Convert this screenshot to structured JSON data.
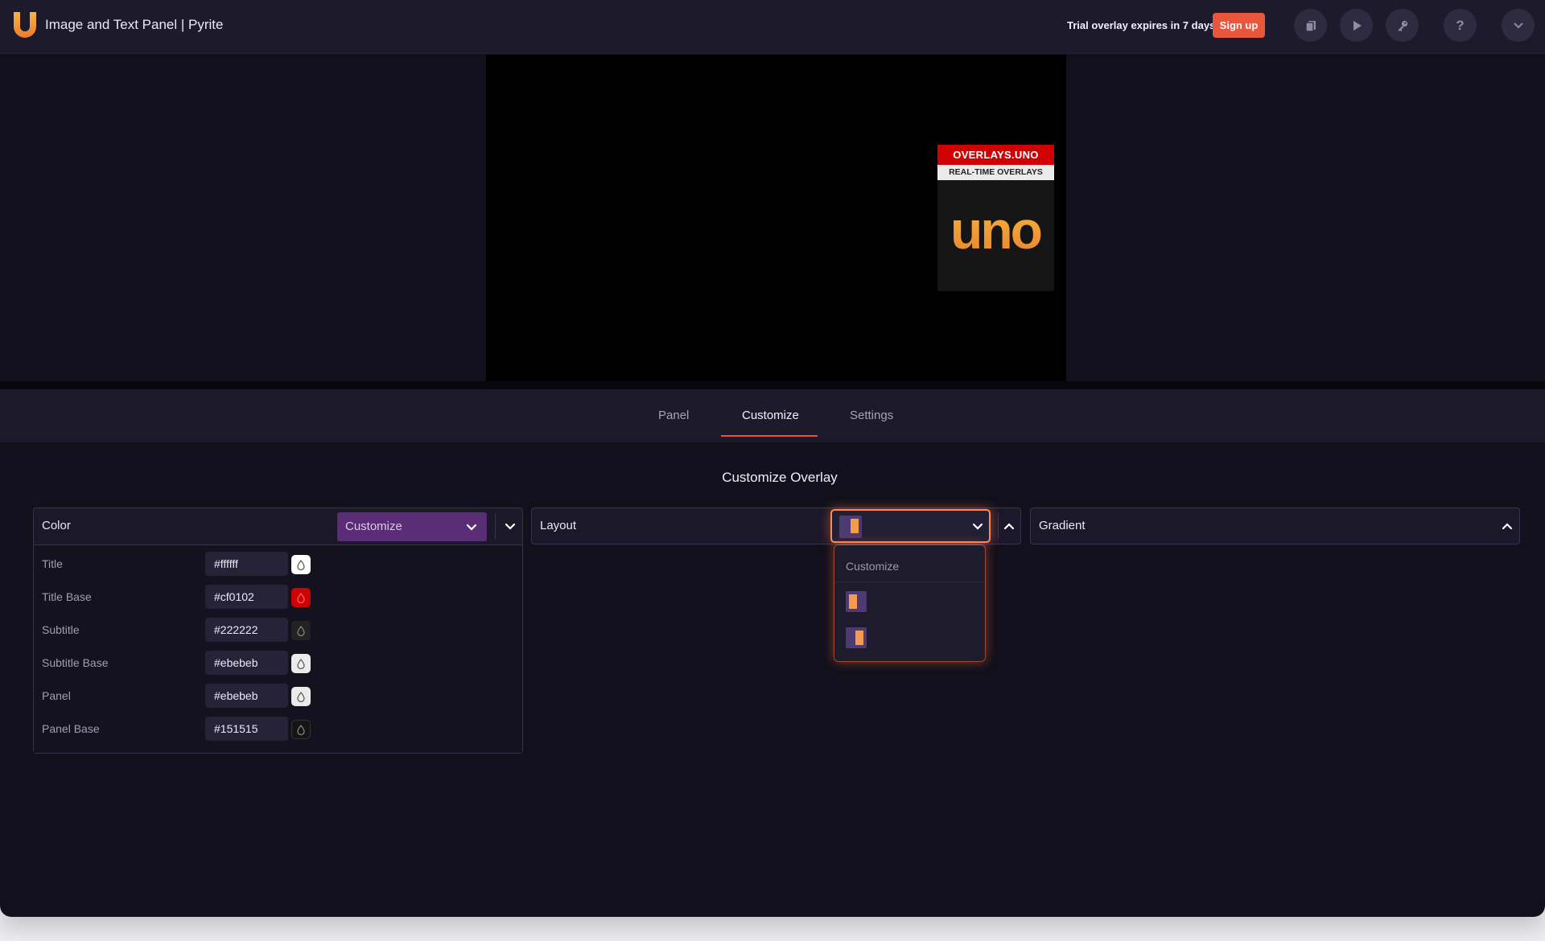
{
  "header": {
    "title": "Image and Text Panel | Pyrite",
    "trial_text": "Trial overlay expires in 7 days",
    "signup_label": "Sign up",
    "icons": [
      "clipboard-icon",
      "play-icon",
      "key-icon",
      "help-icon",
      "chevron-down-icon"
    ],
    "help_glyph": "?"
  },
  "overlay": {
    "title": "OVERLAYS.UNO",
    "subtitle": "REAL-TIME OVERLAYS",
    "image_text": "uno"
  },
  "tabs": [
    {
      "label": "Panel",
      "active": false
    },
    {
      "label": "Customize",
      "active": true
    },
    {
      "label": "Settings",
      "active": false
    }
  ],
  "customize": {
    "heading": "Customize Overlay",
    "color": {
      "label": "Color",
      "preset": "Customize",
      "rows": [
        {
          "label": "Title",
          "value": "#ffffff"
        },
        {
          "label": "Title Base",
          "value": "#cf0102"
        },
        {
          "label": "Subtitle",
          "value": "#222222"
        },
        {
          "label": "Subtitle Base",
          "value": "#ebebeb"
        },
        {
          "label": "Panel",
          "value": "#ebebeb"
        },
        {
          "label": "Panel Base",
          "value": "#151515"
        }
      ]
    },
    "layout": {
      "label": "Layout",
      "menu_header": "Customize",
      "options": [
        "layout-left-bar",
        "layout-right-bar"
      ],
      "selected": "layout-right-bar"
    },
    "gradient": {
      "label": "Gradient"
    }
  },
  "colors": {
    "accent": "#e8563b",
    "app_bg": "#12101c",
    "header_bg": "#1d1a2c",
    "select_purple": "#5a2d76",
    "thumb_purple": "#4e3a72",
    "thumb_orange": "#f49b4e"
  }
}
